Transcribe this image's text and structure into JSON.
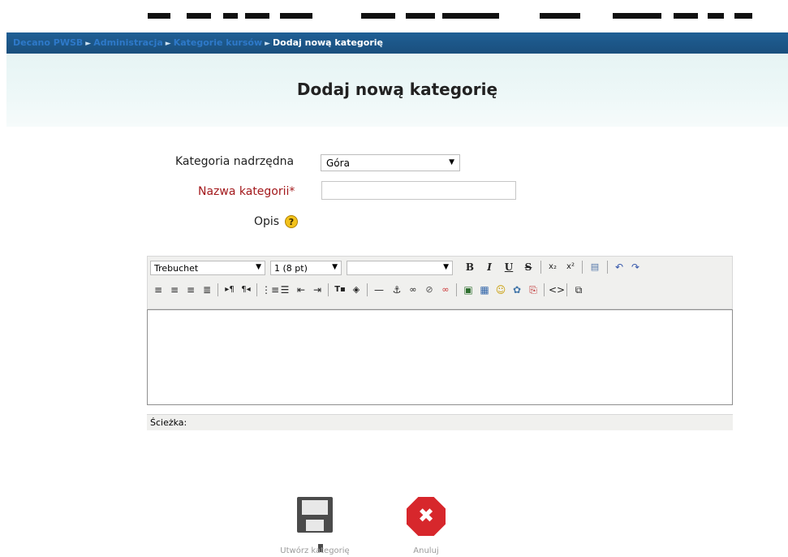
{
  "breadcrumb": {
    "items": [
      "Decano PWSB",
      "Administracja",
      "Kategorie kursów"
    ],
    "current": "Dodaj nową kategorię",
    "separator": "►"
  },
  "page": {
    "title": "Dodaj nową kategorię"
  },
  "form": {
    "parent_label": "Kategoria nadrzędna",
    "parent_value": "Góra",
    "name_label": "Nazwa kategorii*",
    "name_value": "",
    "desc_label": "Opis",
    "help_icon": "help-icon"
  },
  "editor": {
    "font_value": "Trebuchet",
    "size_value": "1 (8 pt)",
    "style_value": "",
    "path_label": "Ścieżka:"
  },
  "actions": {
    "create_label": "Utwórz kategorię",
    "cancel_label": "Anuluj"
  },
  "colors": {
    "navbar": "#1e5a8e",
    "link": "#2e79c9",
    "required": "#a3191c",
    "heading_band": "#eef8f8"
  }
}
